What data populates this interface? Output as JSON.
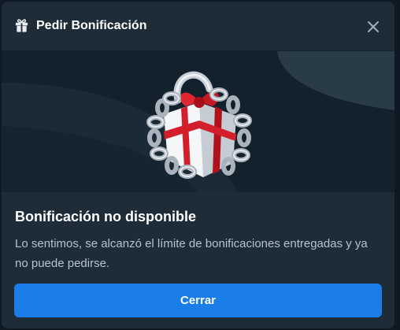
{
  "dialog": {
    "title": "Pedir Bonificación",
    "title_icon": "gift-icon",
    "close_icon": "close-icon"
  },
  "illustration": {
    "name": "chained-gift-illustration"
  },
  "content": {
    "heading": "Bonificación no disponible",
    "message": "Lo sentimos, se alcanzó el límite de bonificaciones entregadas y ya no puede pedirse."
  },
  "actions": {
    "close_label": "Cerrar"
  },
  "colors": {
    "modal_bg": "#1e2c37",
    "banner_bg": "#13212d",
    "primary_button": "#1b7de8",
    "text_primary": "#ffffff",
    "text_secondary": "#b6c2cc"
  }
}
